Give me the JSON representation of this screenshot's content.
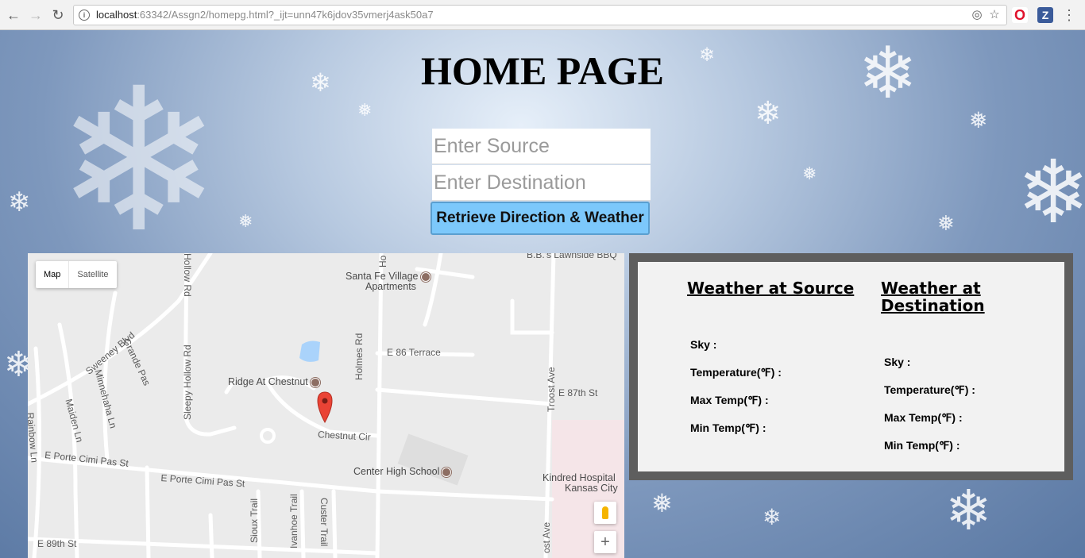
{
  "browser": {
    "url_host": "localhost",
    "url_rest": ":63342/Assgn2/homepg.html?_ijt=unn47k6jdov35vmerj4ask50a7"
  },
  "page": {
    "title": "HOME PAGE",
    "source_placeholder": "Enter Source",
    "destination_placeholder": "Enter Destination",
    "retrieve_label": "Retrieve Direction & Weather"
  },
  "map": {
    "type_map": "Map",
    "type_satellite": "Satellite",
    "labels": {
      "bbs": "B.B.'s Lawnside BBQ",
      "santa_fe_1": "Santa Fe Village",
      "santa_fe_2": "Apartments",
      "holmes": "Holmes Rd",
      "e86": "E 86 Terrace",
      "troost": "Troost Ave",
      "e87": "E 87th St",
      "ridge": "Ridge At Chestnut",
      "chestnut": "Chestnut Cir",
      "sweeney": "Sweeney Blvd",
      "grande": "Grande Pas",
      "minnehaha": "Minnehaha Ln",
      "maiden": "Maiden Ln",
      "rainbow": "Rainbow Ln",
      "hollow_top": "Hollow Rd",
      "sleepy": "Sleepy Hollow Rd",
      "porte1": "E Porte Cimi Pas St",
      "porte2": "E Porte Cimi Pas St",
      "center": "Center High School",
      "kindred_1": "Kindred Hospital",
      "kindred_2": "Kansas City",
      "sioux": "Sioux Trail",
      "ivanhoe": "Ivanhoe Trail",
      "custer": "Custer Trail",
      "e89": "E 89th St",
      "troost_bottom": "ost Ave",
      "holmes_top": "Ho"
    },
    "zoom_in": "+"
  },
  "weather": {
    "source_title": "Weather at Source",
    "destination_title_1": "Weather at",
    "destination_title_2": "Destination",
    "sky": "Sky :",
    "temperature": "Temperature(℉) :",
    "max_temp": "Max Temp(℉) :",
    "min_temp": "Min Temp(℉) :"
  }
}
